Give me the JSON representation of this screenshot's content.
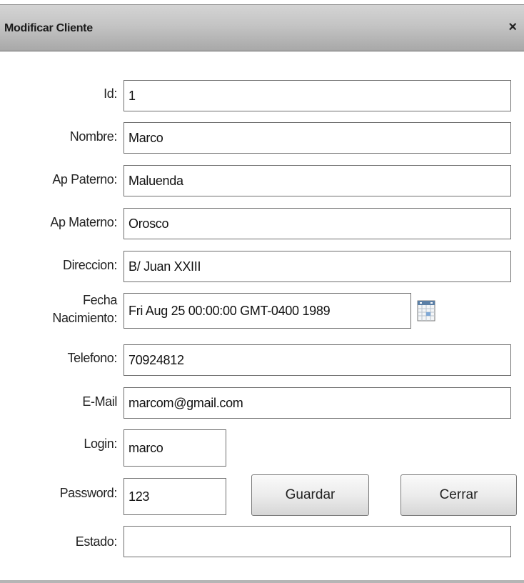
{
  "window": {
    "title": "Modificar Cliente",
    "close_glyph": "×"
  },
  "form": {
    "id": {
      "label": "Id:",
      "value": "1"
    },
    "nombre": {
      "label": "Nombre:",
      "value": "Marco"
    },
    "ap_paterno": {
      "label": "Ap Paterno:",
      "value": "Maluenda"
    },
    "ap_materno": {
      "label": "Ap Materno:",
      "value": "Orosco"
    },
    "direccion": {
      "label": "Direccion:",
      "value": "B/ Juan XXIII"
    },
    "fecha_nacimiento": {
      "label_line1": "Fecha",
      "label_line2": "Nacimiento:",
      "value": "Fri Aug 25 00:00:00 GMT-0400 1989",
      "icon": "calendar-icon"
    },
    "telefono": {
      "label": "Telefono:",
      "value": "70924812"
    },
    "email": {
      "label": "E-Mail",
      "value": "marcom@gmail.com"
    },
    "login": {
      "label": "Login:",
      "value": "marco"
    },
    "password": {
      "label": "Password:",
      "value": "123"
    },
    "estado": {
      "label": "Estado:",
      "value": ""
    }
  },
  "buttons": {
    "guardar": "Guardar",
    "cerrar": "Cerrar"
  }
}
